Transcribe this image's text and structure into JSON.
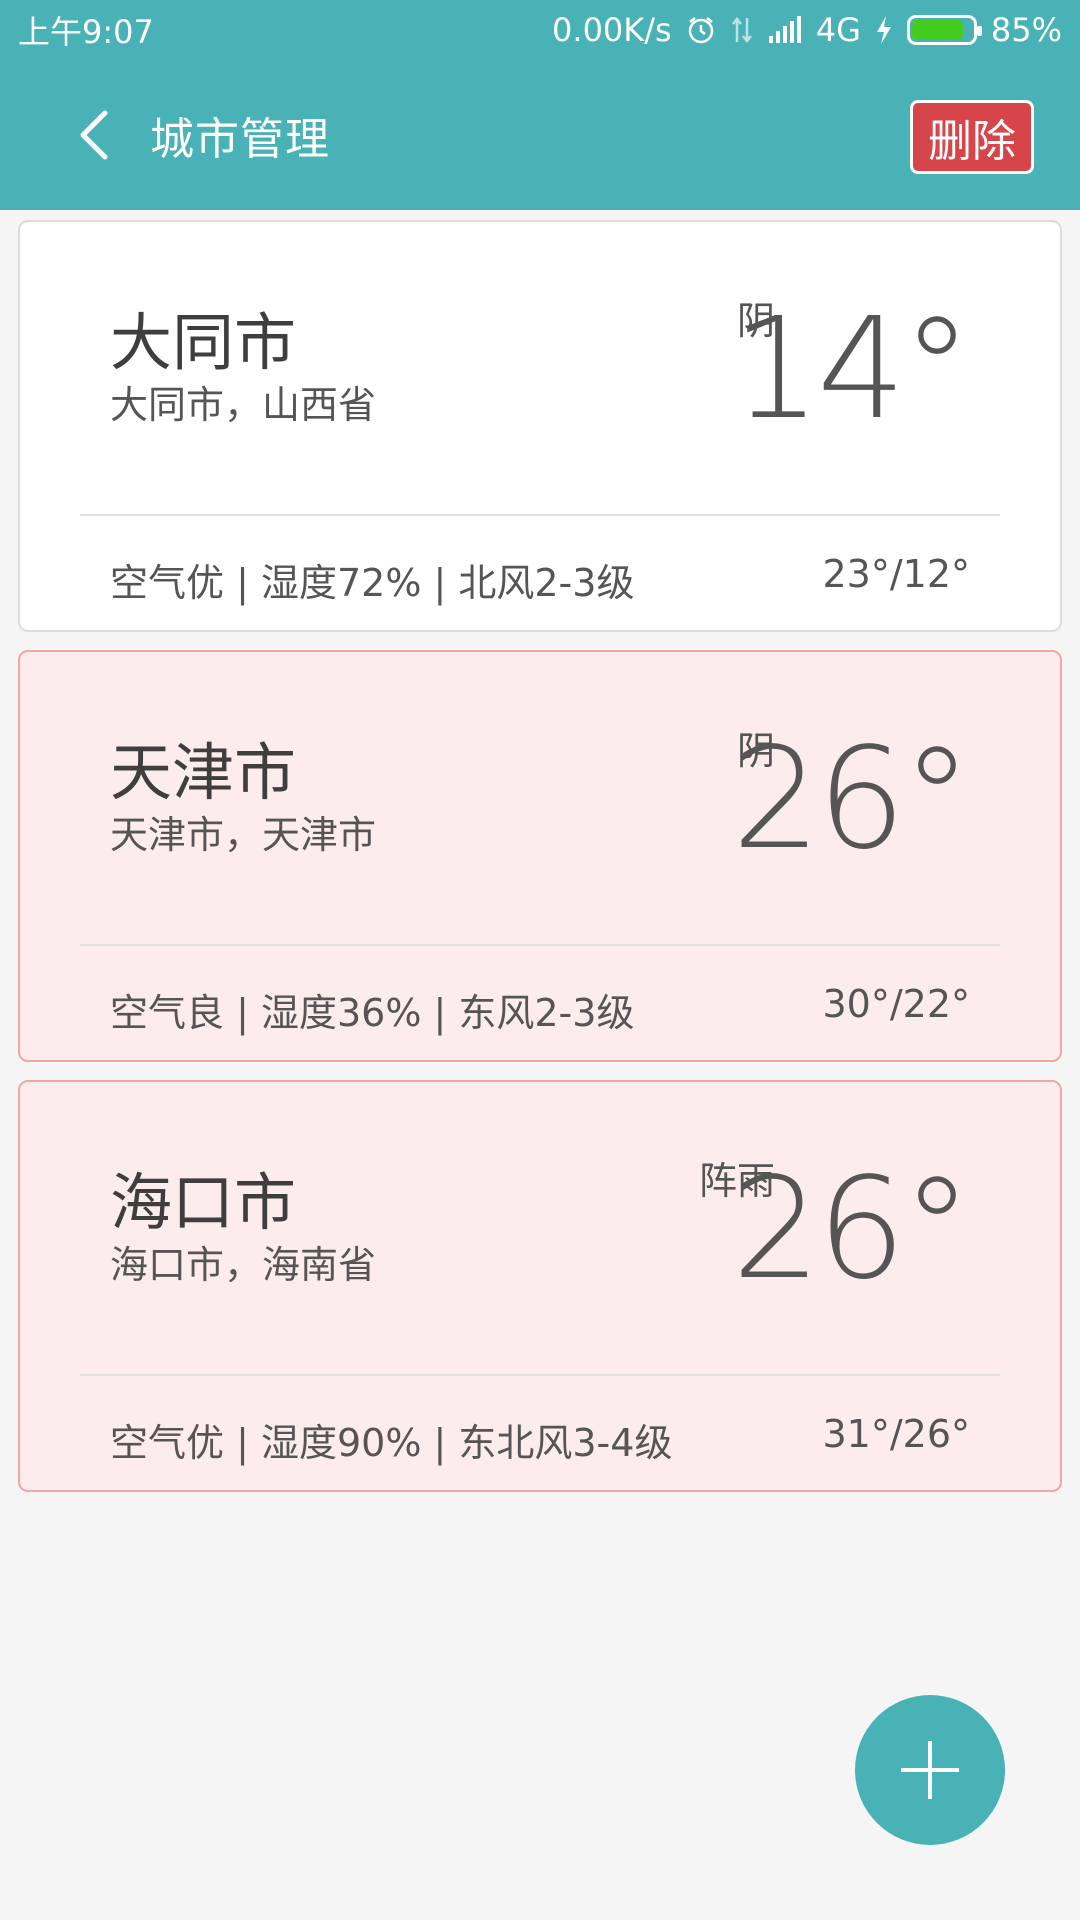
{
  "status_bar": {
    "time": "上午9:07",
    "network_speed": "0.00K/s",
    "network_type": "4G",
    "battery_percent": "85%",
    "battery_level": 0.85,
    "icons": [
      "alarm-icon",
      "data-transfer-icon",
      "signal-icon",
      "charging-icon",
      "battery-icon"
    ]
  },
  "app_bar": {
    "title": "城市管理",
    "back_icon": "back-arrow-icon",
    "delete_label": "删除"
  },
  "cities": [
    {
      "name": "大同市",
      "region": "大同市，山西省",
      "condition": "阴",
      "temp": "14°",
      "detail": "空气优 | 湿度72% | 北风2-3级",
      "range": "23°/12°",
      "selected": false
    },
    {
      "name": "天津市",
      "region": "天津市，天津市",
      "condition": "阴",
      "temp": "26°",
      "detail": "空气良 | 湿度36% | 东风2-3级",
      "range": "30°/22°",
      "selected": true
    },
    {
      "name": "海口市",
      "region": "海口市，海南省",
      "condition": "阵雨",
      "temp": "26°",
      "detail": "空气优 | 湿度90% | 东北风3-4级",
      "range": "31°/26°",
      "selected": true
    }
  ],
  "fab": {
    "icon": "plus-icon"
  },
  "colors": {
    "primary": "#49b2b6",
    "delete": "#d64549",
    "selected_card_bg": "#fdecec",
    "battery_fill": "#43cc1f"
  }
}
